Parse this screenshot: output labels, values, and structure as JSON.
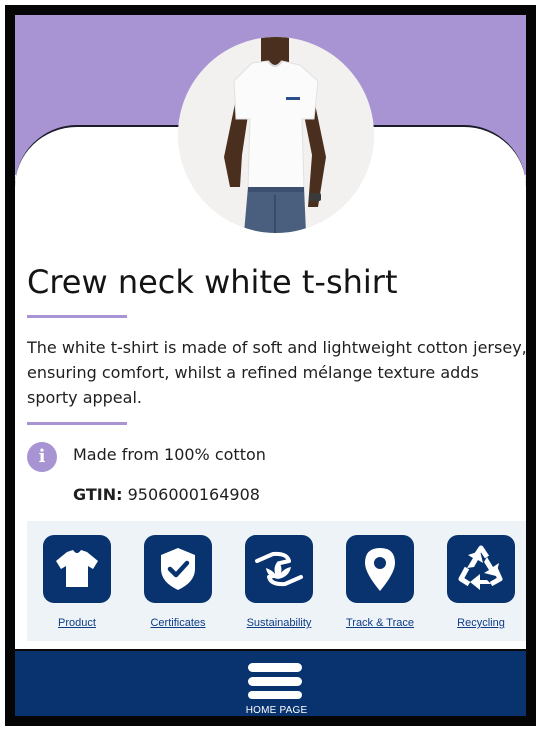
{
  "product": {
    "title": "Crew neck white t-shirt",
    "description": "The white t-shirt is made of soft and lightweight cotton jersey, ensuring comfort, whilst a refined mélange texture adds sporty appeal.",
    "info_icon_glyph": "i",
    "material": "Made from 100% cotton",
    "gtin_label": "GTIN:",
    "gtin_value": "9506000164908"
  },
  "nav": {
    "items": [
      {
        "label": "Product",
        "icon": "tshirt-icon"
      },
      {
        "label": "Certificates",
        "icon": "shield-check-icon"
      },
      {
        "label": "Sustainability",
        "icon": "hand-leaf-icon"
      },
      {
        "label": "Track & Trace",
        "icon": "location-pin-icon"
      },
      {
        "label": "Recycling",
        "icon": "recycle-icon"
      }
    ]
  },
  "footer": {
    "home_label": "HOME PAGE",
    "menu_icon": "hamburger-menu-icon"
  },
  "colors": {
    "hero": "#a994d3",
    "accent": "#a994d3",
    "navy": "#08336e",
    "link": "#0e3d85",
    "panel": "#eef3f8"
  }
}
